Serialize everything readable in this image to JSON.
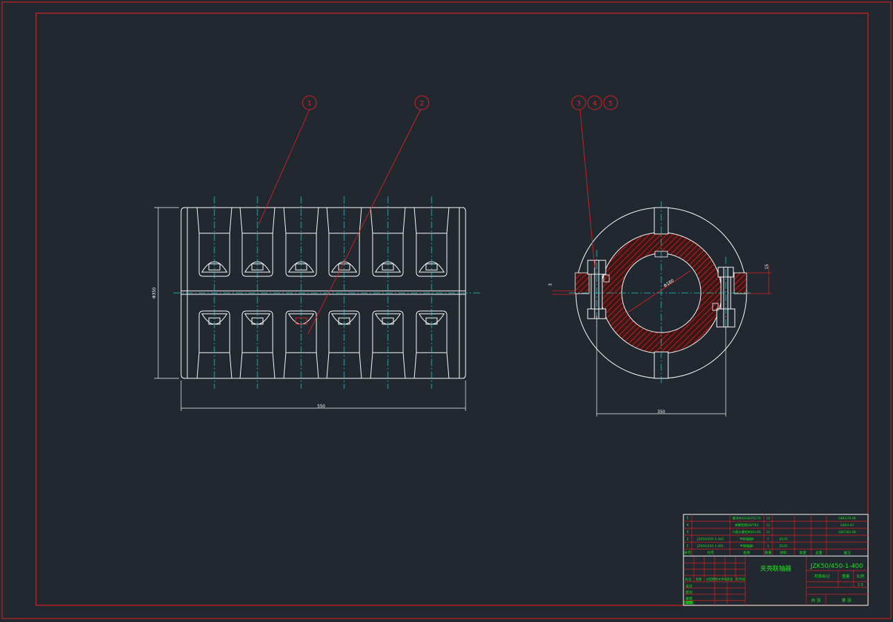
{
  "balloons": [
    "1",
    "2",
    "3",
    "4",
    "5"
  ],
  "dims": {
    "length": "550",
    "height": "Φ350",
    "right_width": "350",
    "bore": "Φ180",
    "slot": "15",
    "gap": "3"
  },
  "title_block": {
    "parts_rows": [
      {
        "no": "5",
        "code": "",
        "name": "螺母M20GB/T6170",
        "qty": "12",
        "material": "",
        "note": "GB6170-86"
      },
      {
        "no": "4",
        "code": "",
        "name": "弹簧垫圈GB/T93",
        "qty": "12",
        "material": "",
        "note": "GB93-87"
      },
      {
        "no": "3",
        "code": "",
        "name": "六角头螺栓M20×95",
        "qty": "12",
        "material": "",
        "note": "GB5782-86"
      },
      {
        "no": "2",
        "code": "JZK50/450-1-402",
        "name": "半联轴器Ⅱ",
        "qty": "1",
        "material": "ZG35",
        "note": ""
      },
      {
        "no": "1",
        "code": "JZK50/450-1-401",
        "name": "半联轴器Ⅰ",
        "qty": "1",
        "material": "ZG35",
        "note": ""
      }
    ],
    "header": [
      "序号",
      "代号",
      "名称",
      "数量",
      "材料",
      "单重",
      "总重",
      "备注"
    ],
    "title": "夹壳联轴器",
    "drawing_no": "JZK50/450-1-400",
    "stage_label": "阶段标记",
    "weight_label": "重量",
    "scale_label": "比例",
    "scale": "1:5",
    "sheet_label": "共 张",
    "sheet2_label": "第 张",
    "rev_labels": [
      "标记",
      "处数",
      "分区",
      "更改文件号",
      "签名",
      "年月日"
    ],
    "sign_labels": [
      "设计",
      "校对",
      "审核",
      "工艺",
      "标准化",
      "批准"
    ]
  }
}
